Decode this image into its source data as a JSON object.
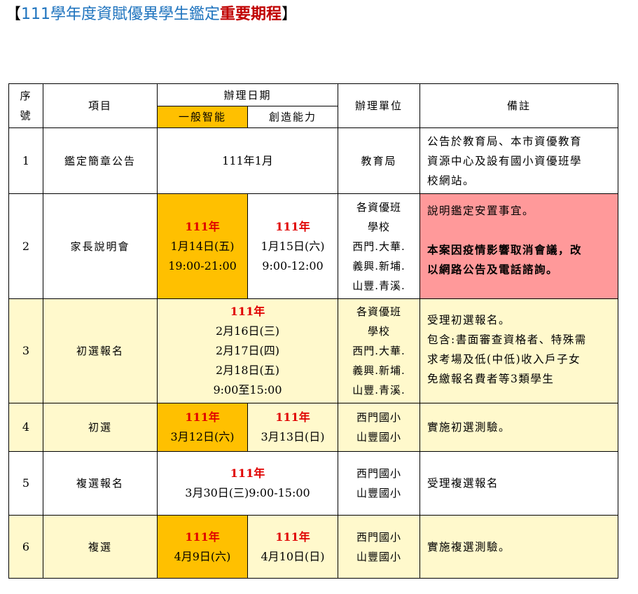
{
  "title": {
    "open_bracket": "【",
    "main": "111學年度資賦優異學生鑑定",
    "highlight": "重要期程",
    "close_bracket": "】"
  },
  "table": {
    "headers": {
      "seq": [
        "序",
        "號"
      ],
      "item": "項目",
      "date": "辦理日期",
      "general": "一般智能",
      "creative": "創造能力",
      "unit": "辦理單位",
      "note": "備註"
    },
    "rows": [
      {
        "seq": "1",
        "item": "鑑定簡章公告",
        "date": "111年1月",
        "unit": "教育局",
        "note": [
          "公告於教育局、本市資優教育",
          "資源中心及設有國小資優班學",
          "校網站。"
        ]
      },
      {
        "seq": "2",
        "item": "家長說明會",
        "general": [
          "111年",
          "1月14日(五)",
          "19:00-21:00"
        ],
        "creative": [
          "111年",
          "1月15日(六)",
          "9:00-12:00"
        ],
        "unit": [
          "各資優班",
          "學校",
          "西門.大華.",
          "義興.新埔.",
          "山豐.青溪."
        ],
        "note": [
          "說明鑑定安置事宜。",
          "本案因疫情影響取消會議，改",
          "以網路公告及電話諮詢。"
        ]
      },
      {
        "seq": "3",
        "item": "初選報名",
        "date": [
          "111年",
          "2月16日(三)",
          "2月17日(四)",
          "2月18日(五)",
          "9:00至15:00"
        ],
        "unit": [
          "各資優班",
          "學校",
          "西門.大華.",
          "義興.新埔.",
          "山豐.青溪."
        ],
        "note": [
          "受理初選報名。",
          "包含:書面審查資格者、特殊需",
          "求考場及低(中低)收入戶子女",
          "免繳報名費者等3類學生"
        ]
      },
      {
        "seq": "4",
        "item": "初選",
        "general": [
          "111年",
          "3月12日(六)"
        ],
        "creative": [
          "111年",
          "3月13日(日)"
        ],
        "unit": [
          "西門國小",
          "山豐國小"
        ],
        "note": "實施初選測驗。"
      },
      {
        "seq": "5",
        "item": "複選報名",
        "date": [
          "111年",
          "3月30日(三)9:00-15:00"
        ],
        "unit": [
          "西門國小",
          "山豐國小"
        ],
        "note": "受理複選報名"
      },
      {
        "seq": "6",
        "item": "複選",
        "general": [
          "111年",
          "4月9日(六)"
        ],
        "creative": [
          "111年",
          "4月10日(日)"
        ],
        "unit": [
          "西門國小",
          "山豐國小"
        ],
        "note": "實施複選測驗。"
      }
    ]
  },
  "colors": {
    "title_blue": "#1e73be",
    "title_red": "#c00000",
    "highlight_orange": "#ffc000",
    "pale_yellow": "#fff9cc",
    "pink": "#ff999a",
    "year_red": "#e00000"
  }
}
